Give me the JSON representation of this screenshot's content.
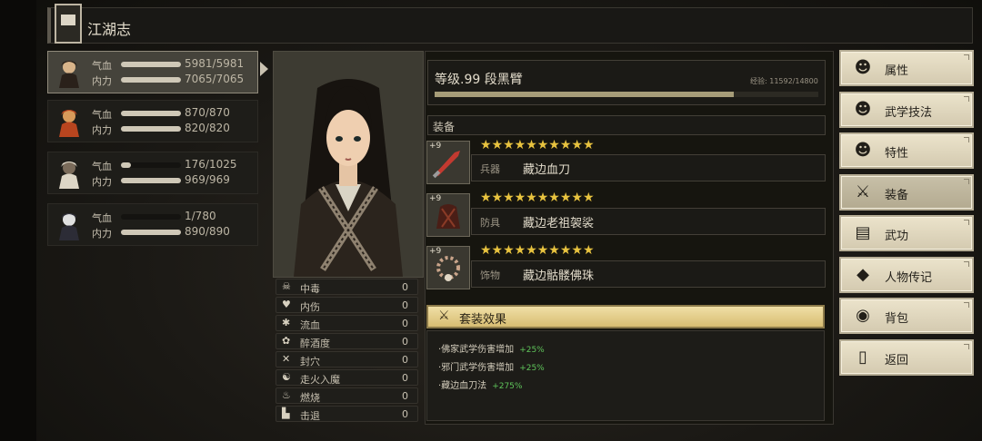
{
  "header": {
    "title": "江湖志"
  },
  "party": [
    {
      "hp_label": "气血",
      "hp": "5981/5981",
      "hp_frac": 1.0,
      "mp_label": "内力",
      "mp": "7065/7065",
      "mp_frac": 1.0,
      "selected": true
    },
    {
      "hp_label": "气血",
      "hp": "870/870",
      "hp_frac": 1.0,
      "mp_label": "内力",
      "mp": "820/820",
      "mp_frac": 1.0
    },
    {
      "hp_label": "气血",
      "hp": "176/1025",
      "hp_frac": 0.17,
      "mp_label": "内力",
      "mp": "969/969",
      "mp_frac": 1.0
    },
    {
      "hp_label": "气血",
      "hp": "1/780",
      "hp_frac": 0.0,
      "mp_label": "内力",
      "mp": "890/890",
      "mp_frac": 1.0
    }
  ],
  "character": {
    "level_line": "等级.99  段黑臂",
    "exp_text": "经验: 11592/14800",
    "exp_frac": 0.78
  },
  "status_effects": [
    {
      "icon": "☠",
      "icon_name": "poison-icon",
      "label": "中毒",
      "value": "0"
    },
    {
      "icon": "♥",
      "icon_name": "broken-heart-icon",
      "label": "内伤",
      "value": "0"
    },
    {
      "icon": "✱",
      "icon_name": "bleed-icon",
      "label": "流血",
      "value": "0"
    },
    {
      "icon": "✿",
      "icon_name": "drunk-icon",
      "label": "醉酒度",
      "value": "0"
    },
    {
      "icon": "✕",
      "icon_name": "seal-icon",
      "label": "封穴",
      "value": "0"
    },
    {
      "icon": "☯",
      "icon_name": "qi-deviation-icon",
      "label": "走火入魔",
      "value": "0"
    },
    {
      "icon": "♨",
      "icon_name": "burn-icon",
      "label": "燃烧",
      "value": "0"
    },
    {
      "icon": "▙",
      "icon_name": "knockback-icon",
      "label": "击退",
      "value": "0"
    }
  ],
  "equipment": {
    "section_label": "装备",
    "items": [
      {
        "plus": "+9",
        "stars": "★★★★★★★★★★",
        "slot": "兵器",
        "name": "藏边血刀"
      },
      {
        "plus": "+9",
        "stars": "★★★★★★★★★★",
        "slot": "防具",
        "name": "藏边老祖袈裟"
      },
      {
        "plus": "+9",
        "stars": "★★★★★★★★★★",
        "slot": "饰物",
        "name": "藏边骷髅佛珠"
      }
    ]
  },
  "set_bonus": {
    "title": "套装效果",
    "items": [
      {
        "text": "·佛家武学伤害增加",
        "value": "+25%"
      },
      {
        "text": "·邪门武学伤害增加",
        "value": "+25%"
      },
      {
        "text": "·藏边血刀法",
        "value": "+275%"
      }
    ]
  },
  "menu": [
    {
      "label": "属性",
      "icon": "☻",
      "icon_name": "attributes-icon"
    },
    {
      "label": "武学技法",
      "icon": "☻",
      "icon_name": "martial-skills-icon"
    },
    {
      "label": "特性",
      "icon": "☻",
      "icon_name": "traits-icon"
    },
    {
      "label": "装备",
      "icon": "⚔",
      "icon_name": "sword-icon",
      "active": true
    },
    {
      "label": "武功",
      "icon": "▤",
      "icon_name": "manual-icon"
    },
    {
      "label": "人物传记",
      "icon": "◆",
      "icon_name": "biography-icon"
    },
    {
      "label": "背包",
      "icon": "◉",
      "icon_name": "bag-icon"
    },
    {
      "label": "返回",
      "icon": "▯",
      "icon_name": "door-icon"
    }
  ],
  "colors": {
    "star": "#e8c33f",
    "bonus_green": "#5fc45a",
    "menu_bg": "#e4dcc2"
  }
}
